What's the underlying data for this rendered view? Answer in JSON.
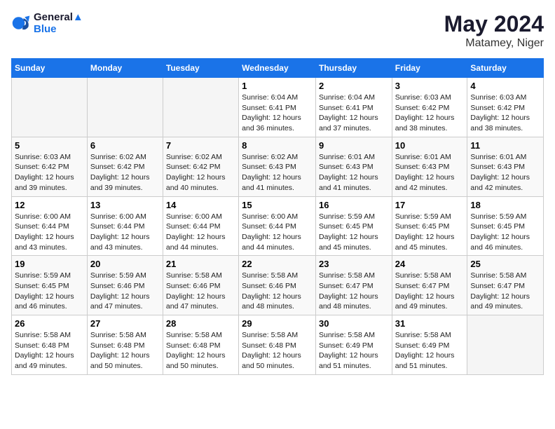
{
  "logo": {
    "line1": "General",
    "line2": "Blue"
  },
  "title": "May 2024",
  "location": "Matamey, Niger",
  "days_header": [
    "Sunday",
    "Monday",
    "Tuesday",
    "Wednesday",
    "Thursday",
    "Friday",
    "Saturday"
  ],
  "weeks": [
    [
      {
        "day": "",
        "text": ""
      },
      {
        "day": "",
        "text": ""
      },
      {
        "day": "",
        "text": ""
      },
      {
        "day": "1",
        "text": "Sunrise: 6:04 AM\nSunset: 6:41 PM\nDaylight: 12 hours and 36 minutes."
      },
      {
        "day": "2",
        "text": "Sunrise: 6:04 AM\nSunset: 6:41 PM\nDaylight: 12 hours and 37 minutes."
      },
      {
        "day": "3",
        "text": "Sunrise: 6:03 AM\nSunset: 6:42 PM\nDaylight: 12 hours and 38 minutes."
      },
      {
        "day": "4",
        "text": "Sunrise: 6:03 AM\nSunset: 6:42 PM\nDaylight: 12 hours and 38 minutes."
      }
    ],
    [
      {
        "day": "5",
        "text": "Sunrise: 6:03 AM\nSunset: 6:42 PM\nDaylight: 12 hours and 39 minutes."
      },
      {
        "day": "6",
        "text": "Sunrise: 6:02 AM\nSunset: 6:42 PM\nDaylight: 12 hours and 39 minutes."
      },
      {
        "day": "7",
        "text": "Sunrise: 6:02 AM\nSunset: 6:42 PM\nDaylight: 12 hours and 40 minutes."
      },
      {
        "day": "8",
        "text": "Sunrise: 6:02 AM\nSunset: 6:43 PM\nDaylight: 12 hours and 41 minutes."
      },
      {
        "day": "9",
        "text": "Sunrise: 6:01 AM\nSunset: 6:43 PM\nDaylight: 12 hours and 41 minutes."
      },
      {
        "day": "10",
        "text": "Sunrise: 6:01 AM\nSunset: 6:43 PM\nDaylight: 12 hours and 42 minutes."
      },
      {
        "day": "11",
        "text": "Sunrise: 6:01 AM\nSunset: 6:43 PM\nDaylight: 12 hours and 42 minutes."
      }
    ],
    [
      {
        "day": "12",
        "text": "Sunrise: 6:00 AM\nSunset: 6:44 PM\nDaylight: 12 hours and 43 minutes."
      },
      {
        "day": "13",
        "text": "Sunrise: 6:00 AM\nSunset: 6:44 PM\nDaylight: 12 hours and 43 minutes."
      },
      {
        "day": "14",
        "text": "Sunrise: 6:00 AM\nSunset: 6:44 PM\nDaylight: 12 hours and 44 minutes."
      },
      {
        "day": "15",
        "text": "Sunrise: 6:00 AM\nSunset: 6:44 PM\nDaylight: 12 hours and 44 minutes."
      },
      {
        "day": "16",
        "text": "Sunrise: 5:59 AM\nSunset: 6:45 PM\nDaylight: 12 hours and 45 minutes."
      },
      {
        "day": "17",
        "text": "Sunrise: 5:59 AM\nSunset: 6:45 PM\nDaylight: 12 hours and 45 minutes."
      },
      {
        "day": "18",
        "text": "Sunrise: 5:59 AM\nSunset: 6:45 PM\nDaylight: 12 hours and 46 minutes."
      }
    ],
    [
      {
        "day": "19",
        "text": "Sunrise: 5:59 AM\nSunset: 6:45 PM\nDaylight: 12 hours and 46 minutes."
      },
      {
        "day": "20",
        "text": "Sunrise: 5:59 AM\nSunset: 6:46 PM\nDaylight: 12 hours and 47 minutes."
      },
      {
        "day": "21",
        "text": "Sunrise: 5:58 AM\nSunset: 6:46 PM\nDaylight: 12 hours and 47 minutes."
      },
      {
        "day": "22",
        "text": "Sunrise: 5:58 AM\nSunset: 6:46 PM\nDaylight: 12 hours and 48 minutes."
      },
      {
        "day": "23",
        "text": "Sunrise: 5:58 AM\nSunset: 6:47 PM\nDaylight: 12 hours and 48 minutes."
      },
      {
        "day": "24",
        "text": "Sunrise: 5:58 AM\nSunset: 6:47 PM\nDaylight: 12 hours and 49 minutes."
      },
      {
        "day": "25",
        "text": "Sunrise: 5:58 AM\nSunset: 6:47 PM\nDaylight: 12 hours and 49 minutes."
      }
    ],
    [
      {
        "day": "26",
        "text": "Sunrise: 5:58 AM\nSunset: 6:48 PM\nDaylight: 12 hours and 49 minutes."
      },
      {
        "day": "27",
        "text": "Sunrise: 5:58 AM\nSunset: 6:48 PM\nDaylight: 12 hours and 50 minutes."
      },
      {
        "day": "28",
        "text": "Sunrise: 5:58 AM\nSunset: 6:48 PM\nDaylight: 12 hours and 50 minutes."
      },
      {
        "day": "29",
        "text": "Sunrise: 5:58 AM\nSunset: 6:48 PM\nDaylight: 12 hours and 50 minutes."
      },
      {
        "day": "30",
        "text": "Sunrise: 5:58 AM\nSunset: 6:49 PM\nDaylight: 12 hours and 51 minutes."
      },
      {
        "day": "31",
        "text": "Sunrise: 5:58 AM\nSunset: 6:49 PM\nDaylight: 12 hours and 51 minutes."
      },
      {
        "day": "",
        "text": ""
      }
    ]
  ]
}
